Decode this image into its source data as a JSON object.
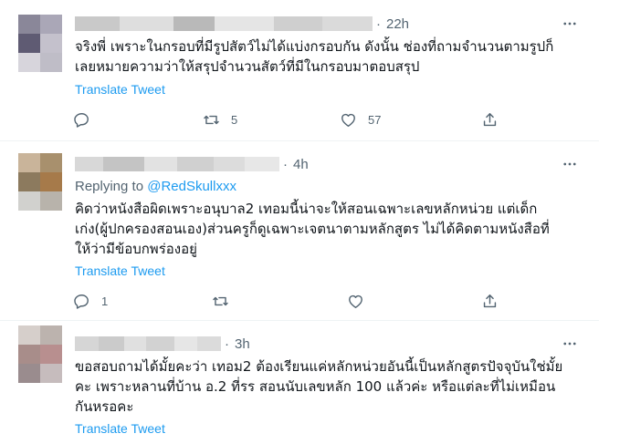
{
  "tweets": [
    {
      "time": "22h",
      "body": "จริงพี่ เพราะในกรอบที่มีรูปสัตว์ไม่ได้แบ่งกรอบกัน ดังนั้น ช่องที่ถามจำนวนตามรูปก็\nเลยหมายความว่าให้สรุปจำนวนสัตว์ที่มีในกรอบมาตอบสรุป",
      "translate": "Translate Tweet",
      "reply_count": "",
      "retweet_count": "5",
      "like_count": "57",
      "avatar_colors": [
        "#8a8799",
        "#aaa7b7",
        "#5f5b73",
        "#c4c1cc",
        "#d7d5dc",
        "#bfbdc7"
      ],
      "name_colors": [
        "#c9c9c9",
        "#dedede",
        "#b9b9b9",
        "#e5e5e5",
        "#cfcfcf",
        "#dadada"
      ]
    },
    {
      "time": "4h",
      "replying_prefix": "Replying to",
      "replying_handle": "@RedSkullxxx",
      "body": "คิดว่าหนังสือผิดเพราะอนุบาล2 เทอมนี้น่าจะให้สอนเฉพาะเลขหลักหน่วย แต่เด็ก\nเก่ง(ผู้ปกครองสอนเอง)ส่วนครูก็ดูเฉพาะเจตนาตามหลักสูตร ไม่ได้คิดตามหนังสือที่\nให้ว่ามีข้อบกพร่องอยู่",
      "translate": "Translate Tweet",
      "reply_count": "1",
      "retweet_count": "",
      "like_count": "",
      "avatar_colors": [
        "#c9b49a",
        "#a8906d",
        "#8c7a5e",
        "#a67a4a",
        "#d1d1ce",
        "#b8b3ab"
      ],
      "name_colors": [
        "#d8d8d8",
        "#c4c4c4",
        "#e2e2e2",
        "#d0d0d0",
        "#dcdcdc",
        "#e7e7e7"
      ]
    },
    {
      "time": "3h",
      "body": "ขอสอบถามได้มั้ยคะว่า เทอม2 ต้องเรียนแค่หลักหน่วยอันนี้เป็นหลักสูตรปัจจุบันใช่มั้ย\nคะ เพราะหลานที่บ้าน อ.2 ที่รร สอนนับเลขหลัก 100 แล้วค่ะ หรือแต่ละที่ไม่เหมือน\nกันหรอคะ",
      "translate": "Translate Tweet",
      "avatar_colors": [
        "#d6cfcb",
        "#bcb3ae",
        "#a88d8a",
        "#b88f8f",
        "#9a8c8e",
        "#c6bcbd"
      ],
      "name_colors": [
        "#d6d6d6",
        "#cbcbcb",
        "#e0e0e0",
        "#d2d2d2",
        "#e6e6e6",
        "#dbdbdb"
      ]
    }
  ],
  "icons": {
    "more": "more-horizontal-icon",
    "reply": "reply-icon",
    "retweet": "retweet-icon",
    "like": "like-icon",
    "share": "share-icon"
  }
}
